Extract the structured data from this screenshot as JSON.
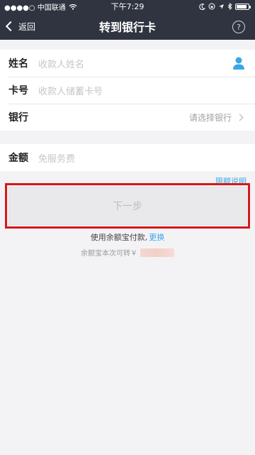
{
  "status_bar": {
    "carrier": "●●●●○ 中国联通",
    "time": "下午7:29"
  },
  "nav": {
    "back_label": "返回",
    "title": "转到银行卡",
    "help_symbol": "?"
  },
  "form": {
    "name": {
      "label": "姓名",
      "placeholder": "收款人姓名"
    },
    "card": {
      "label": "卡号",
      "placeholder": "收款人储蓄卡号"
    },
    "bank": {
      "label": "银行",
      "hint": "请选择银行"
    },
    "amount": {
      "label": "金额",
      "placeholder": "免服务费"
    }
  },
  "limit_link": "限额说明",
  "next_button": "下一步",
  "payment": {
    "text": "使用余额宝付款,",
    "change": "更换"
  },
  "balance": {
    "text": "余额宝本次可转￥"
  },
  "colors": {
    "nav_bg": "#2f3440",
    "accent": "#3aa6e7",
    "highlight": "#d61818"
  }
}
